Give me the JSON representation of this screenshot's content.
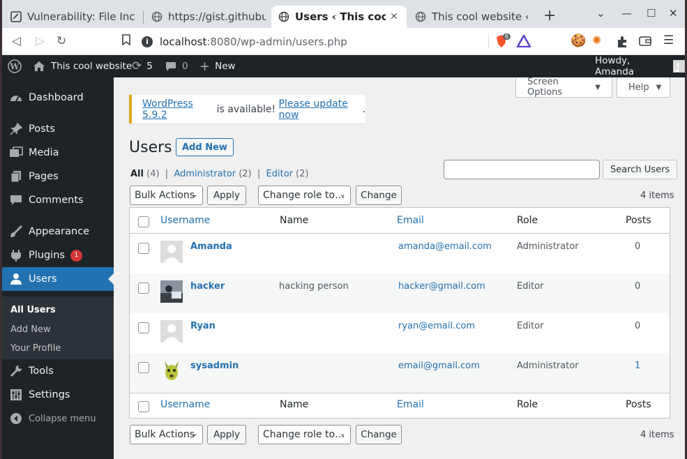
{
  "browser": {
    "tabs": [
      {
        "title": "Vulnerability: File Inclu"
      },
      {
        "title": "https://gist.githubuse"
      },
      {
        "title": "Users ‹ This cool we"
      },
      {
        "title": "This cool website ‹ Los"
      }
    ],
    "url_host": "localhost",
    "url_path": ":8080/wp-admin/users.php",
    "brave_badge": "6"
  },
  "adminbar": {
    "site_name": "This cool website",
    "updates": "5",
    "comments": "0",
    "new": "New",
    "howdy": "Howdy, Amanda"
  },
  "sidebar": {
    "items": [
      {
        "label": "Dashboard"
      },
      {
        "label": "Posts"
      },
      {
        "label": "Media"
      },
      {
        "label": "Pages"
      },
      {
        "label": "Comments"
      },
      {
        "label": "Appearance"
      },
      {
        "label": "Plugins",
        "badge": "1"
      },
      {
        "label": "Users"
      },
      {
        "label": "Tools"
      },
      {
        "label": "Settings"
      },
      {
        "label": "Collapse menu"
      }
    ],
    "submenu": [
      {
        "label": "All Users"
      },
      {
        "label": "Add New"
      },
      {
        "label": "Your Profile"
      }
    ]
  },
  "page": {
    "screen_options": "Screen Options",
    "help": "Help",
    "notice_link1": "WordPress 5.9.2",
    "notice_text": " is available! ",
    "notice_link2": "Please update now",
    "notice_end": ".",
    "title": "Users",
    "add_new": "Add New",
    "filter_all": "All",
    "filter_all_count": " (4)",
    "filter_sep": "|",
    "filter_admin": "Administrator",
    "filter_admin_count": " (2)",
    "filter_editor": "Editor",
    "filter_editor_count": " (2)",
    "search_button": "Search Users",
    "bulk_actions": "Bulk Actions",
    "apply": "Apply",
    "change_role": "Change role to…",
    "change": "Change",
    "items_count": "4 items"
  },
  "table": {
    "columns": [
      "Username",
      "Name",
      "Email",
      "Role",
      "Posts"
    ],
    "rows": [
      {
        "username": "Amanda",
        "name": "",
        "email": "amanda@email.com",
        "role": "Administrator",
        "posts": "0"
      },
      {
        "username": "hacker",
        "name": "hacking person",
        "email": "hacker@gmail.com",
        "role": "Editor",
        "posts": "0"
      },
      {
        "username": "Ryan",
        "name": "",
        "email": "ryan@email.com",
        "role": "Editor",
        "posts": "0"
      },
      {
        "username": "sysadmin",
        "name": "",
        "email": "email@gmail.com",
        "role": "Administrator",
        "posts": "1"
      }
    ]
  }
}
